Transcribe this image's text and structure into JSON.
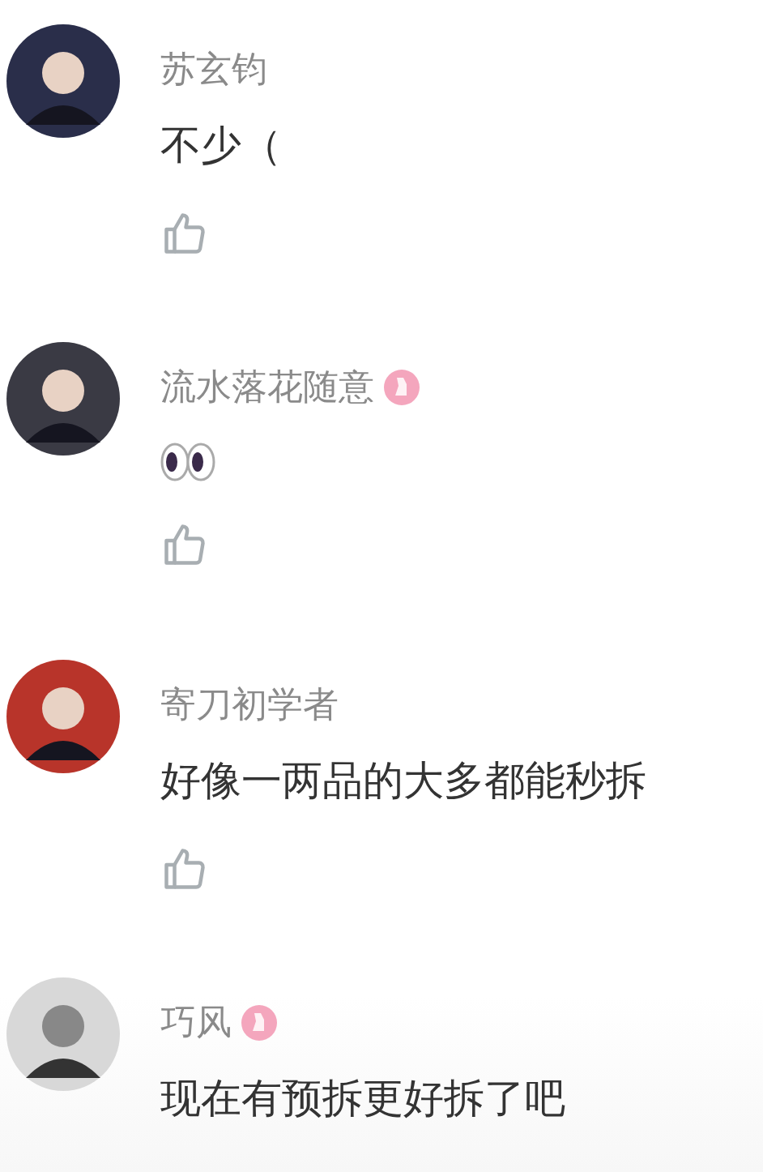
{
  "comments": [
    {
      "name": "苏玄钧",
      "badge": false,
      "content": {
        "kind": "text",
        "text": "不少（"
      },
      "like_button": true
    },
    {
      "name": "流水落花随意",
      "badge": true,
      "content": {
        "kind": "eyes"
      },
      "like_button": true
    },
    {
      "name": "寄刀初学者",
      "badge": false,
      "content": {
        "kind": "text",
        "text": "好像一两品的大多都能秒拆"
      },
      "like_button": true
    },
    {
      "name": "巧风",
      "badge": true,
      "content": {
        "kind": "text",
        "text": "现在有预拆更好拆了吧"
      },
      "like_button": false
    }
  ]
}
